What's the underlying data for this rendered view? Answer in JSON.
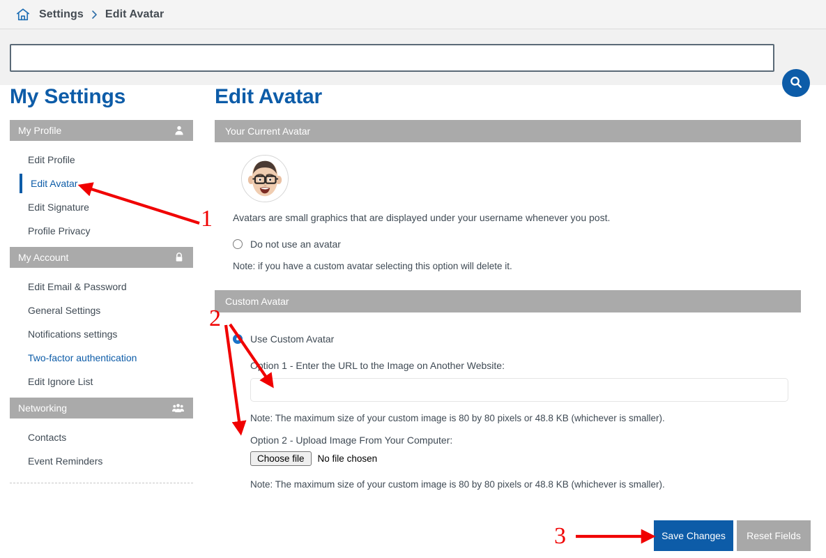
{
  "breadcrumb": {
    "home_icon": "home-icon",
    "items": [
      "Settings",
      "Edit Avatar"
    ],
    "separator": "chevron-right-icon"
  },
  "search": {
    "value": "",
    "placeholder": "",
    "button_icon": "search-icon",
    "accent": "#0d5ca8"
  },
  "sidebar": {
    "title": "My Settings",
    "sections": [
      {
        "header": "My Profile",
        "icon": "user-icon",
        "items": [
          {
            "label": "Edit Profile",
            "state": "default"
          },
          {
            "label": "Edit Avatar",
            "state": "active"
          },
          {
            "label": "Edit Signature",
            "state": "default"
          },
          {
            "label": "Profile Privacy",
            "state": "default"
          }
        ]
      },
      {
        "header": "My Account",
        "icon": "lock-icon",
        "items": [
          {
            "label": "Edit Email & Password",
            "state": "default"
          },
          {
            "label": "General Settings",
            "state": "default"
          },
          {
            "label": "Notifications settings",
            "state": "default"
          },
          {
            "label": "Two-factor authentication",
            "state": "link"
          },
          {
            "label": "Edit Ignore List",
            "state": "default"
          }
        ]
      },
      {
        "header": "Networking",
        "icon": "people-icon",
        "items": [
          {
            "label": "Contacts",
            "state": "default"
          },
          {
            "label": "Event Reminders",
            "state": "default"
          }
        ]
      }
    ]
  },
  "main": {
    "title": "Edit Avatar",
    "current_avatar_panel": {
      "header": "Your Current Avatar",
      "avatar_icon": "memoji-avatar",
      "caption": "Avatars are small graphics that are displayed under your username whenever you post.",
      "no_avatar_option": {
        "label": "Do not use an avatar",
        "checked": false
      },
      "no_avatar_note": "Note: if you have a custom avatar selecting this option will delete it."
    },
    "custom_avatar_panel": {
      "header": "Custom Avatar",
      "use_custom_option": {
        "label": "Use Custom Avatar",
        "checked": true
      },
      "option1_label": "Option 1 - Enter the URL to the Image on Another Website:",
      "url_value": "",
      "url_placeholder": "",
      "option1_note": "Note: The maximum size of your custom image is 80 by 80 pixels or 48.8 KB (whichever is smaller).",
      "option2_label": "Option 2 - Upload Image From Your Computer:",
      "file_button_label": "Choose file",
      "file_status": "No file chosen",
      "option2_note": "Note: The maximum size of your custom image is 80 by 80 pixels or 48.8 KB (whichever is smaller)."
    }
  },
  "footer": {
    "save_label": "Save Changes",
    "reset_label": "Reset Fields",
    "save_color": "#0d5ca8",
    "reset_color": "#a8a8a8"
  },
  "annotations": {
    "color": "#f00000",
    "markers": [
      {
        "number": "1",
        "target": "sidebar-item-edit-avatar"
      },
      {
        "number": "2",
        "target": "custom-avatar-inputs"
      },
      {
        "number": "3",
        "target": "save-changes-button"
      }
    ]
  }
}
